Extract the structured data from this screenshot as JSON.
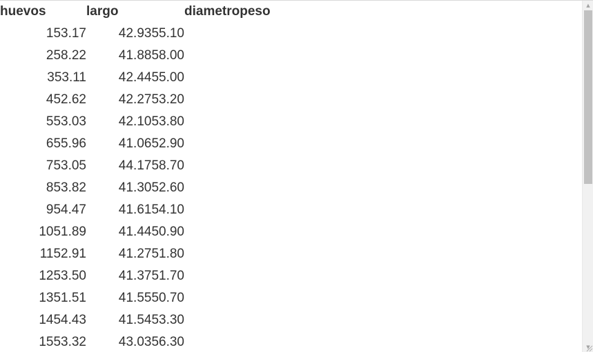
{
  "table": {
    "headers": [
      "huevos",
      "largo",
      "diametro",
      "peso"
    ],
    "rows": [
      {
        "huevos": "1",
        "largo": "53.17",
        "diametro": "42.93",
        "peso": "55.10"
      },
      {
        "huevos": "2",
        "largo": "58.22",
        "diametro": "41.88",
        "peso": "58.00"
      },
      {
        "huevos": "3",
        "largo": "53.11",
        "diametro": "42.44",
        "peso": "55.00"
      },
      {
        "huevos": "4",
        "largo": "52.62",
        "diametro": "42.27",
        "peso": "53.20"
      },
      {
        "huevos": "5",
        "largo": "53.03",
        "diametro": "42.10",
        "peso": "53.80"
      },
      {
        "huevos": "6",
        "largo": "55.96",
        "diametro": "41.06",
        "peso": "52.90"
      },
      {
        "huevos": "7",
        "largo": "53.05",
        "diametro": "44.17",
        "peso": "58.70"
      },
      {
        "huevos": "8",
        "largo": "53.82",
        "diametro": "41.30",
        "peso": "52.60"
      },
      {
        "huevos": "9",
        "largo": "54.47",
        "diametro": "41.61",
        "peso": "54.10"
      },
      {
        "huevos": "10",
        "largo": "51.89",
        "diametro": "41.44",
        "peso": "50.90"
      },
      {
        "huevos": "11",
        "largo": "52.91",
        "diametro": "41.27",
        "peso": "51.80"
      },
      {
        "huevos": "12",
        "largo": "53.50",
        "diametro": "41.37",
        "peso": "51.70"
      },
      {
        "huevos": "13",
        "largo": "51.51",
        "diametro": "41.55",
        "peso": "50.70"
      },
      {
        "huevos": "14",
        "largo": "54.43",
        "diametro": "41.54",
        "peso": "53.30"
      },
      {
        "huevos": "15",
        "largo": "53.32",
        "diametro": "43.03",
        "peso": "56.30"
      }
    ]
  },
  "scrollbar": {
    "up_icon": "triangle-up",
    "down_icon": "triangle-down"
  }
}
